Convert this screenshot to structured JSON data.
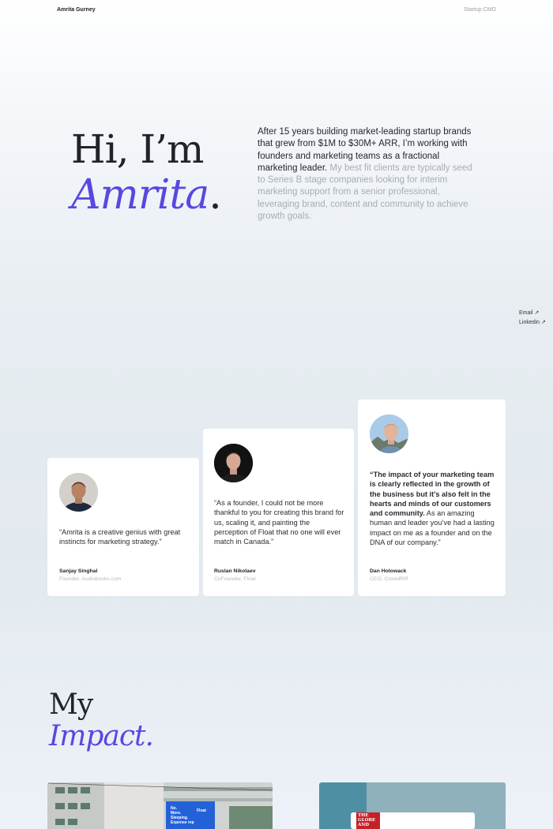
{
  "header": {
    "brand": "Amrita Gurney",
    "role": "Startup CMO"
  },
  "hero": {
    "line1": "Hi, I’m",
    "line2": "Amrita",
    "line2_dot": ".",
    "intro_strong": "After 15 years building market-leading startup brands that grew from $1M to $30M+ ARR, I’m working with founders and marketing teams as a fractional marketing leader.",
    "intro_soft": "My best fit clients are typically seed to Series B stage companies looking for interim marketing support from a senior professional, leveraging brand, content and community to achieve growth goals."
  },
  "links": {
    "email": "Email ↗",
    "linkedin": "Linkedin ↗"
  },
  "testimonials": [
    {
      "quote": "“Amrita is a creative genius with great instincts for marketing strategy.”",
      "name": "Sanjay Singhal",
      "role": "Founder, Audiobooks.com"
    },
    {
      "quote": "“As a founder, I could not be more thankful to you for creating this brand for us, scaling it, and painting the perception of Float that no one will ever match in Canada.”",
      "name": "Ruslan Nikolaev",
      "role": "CoFounder, Float"
    },
    {
      "quote_bold": "“The impact of your marketing team is clearly reflected in the growth of the business but it’s also felt in the hearts and minds of our customers and community.",
      "quote_rest": " As an amazing human and leader you’ve had a lasting impact on me as a founder and on the DNA of our company.”",
      "name": "Dan Holowack",
      "role": "CEO, CrowdRiff"
    }
  ],
  "impact": {
    "line1": "My",
    "line2": "Impact",
    "dot": "."
  },
  "billboard": {
    "text1": "No.",
    "text2": "More.",
    "text3": "Sleeping.",
    "text4": "Expense rep",
    "brand": "Float"
  },
  "newspaper": {
    "line1": "THE",
    "line2": "GLOBE",
    "line3": "AND"
  },
  "colors": {
    "accent": "#5a47e0",
    "text": "#22232a",
    "muted": "#a8adb4"
  }
}
